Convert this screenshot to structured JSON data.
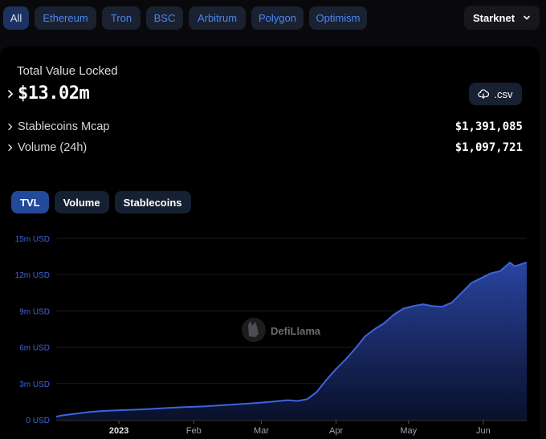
{
  "chain_filters": [
    "All",
    "Ethereum",
    "Tron",
    "BSC",
    "Arbitrum",
    "Polygon",
    "Optimism"
  ],
  "active_filter": "All",
  "chain_select": {
    "value": "Starknet"
  },
  "tvl": {
    "label": "Total Value Locked",
    "value": "$13.02m"
  },
  "csv_button": {
    "label": ".csv"
  },
  "stats": [
    {
      "label": "Stablecoins Mcap",
      "value": "$1,391,085"
    },
    {
      "label": "Volume (24h)",
      "value": "$1,097,721"
    }
  ],
  "tabs": [
    "TVL",
    "Volume",
    "Stablecoins"
  ],
  "active_tab": "TVL",
  "watermark": "DefiLlama",
  "colors": {
    "accent": "#4b86f2",
    "series": "#3e63dd",
    "active_tab": "#23499b"
  },
  "chart_data": {
    "type": "area",
    "y_ticks": [
      "15m USD",
      "12m USD",
      "9m USD",
      "6m USD",
      "3m USD",
      "0 USD"
    ],
    "x_ticks": [
      "2023",
      "Feb",
      "Mar",
      "Apr",
      "May",
      "Jun"
    ],
    "ylim": [
      0,
      15000000
    ],
    "grid": true,
    "series": [
      {
        "x": [
          "2022-12-06",
          "2022-12-08",
          "2022-12-14",
          "2022-12-20",
          "2022-12-27",
          "2023-01-04",
          "2023-01-12",
          "2023-01-20",
          "2023-01-28",
          "2023-02-05",
          "2023-02-13",
          "2023-02-21",
          "2023-02-28",
          "2023-03-06",
          "2023-03-12",
          "2023-03-16",
          "2023-03-20",
          "2023-03-24",
          "2023-03-28",
          "2023-04-01",
          "2023-04-05",
          "2023-04-09",
          "2023-04-13",
          "2023-04-17",
          "2023-04-21",
          "2023-04-25",
          "2023-04-29",
          "2023-05-03",
          "2023-05-07",
          "2023-05-11",
          "2023-05-15",
          "2023-05-19",
          "2023-05-23",
          "2023-05-27",
          "2023-05-31",
          "2023-06-04",
          "2023-06-08",
          "2023-06-12",
          "2023-06-14",
          "2023-06-19"
        ],
        "values": [
          250000,
          350000,
          500000,
          650000,
          750000,
          800000,
          870000,
          960000,
          1050000,
          1100000,
          1200000,
          1300000,
          1400000,
          1500000,
          1620000,
          1550000,
          1700000,
          2300000,
          3300000,
          4200000,
          5000000,
          5900000,
          6900000,
          7500000,
          8000000,
          8700000,
          9200000,
          9400000,
          9550000,
          9400000,
          9350000,
          9700000,
          10500000,
          11300000,
          11700000,
          12100000,
          12300000,
          13000000,
          12700000,
          13000000
        ]
      }
    ]
  }
}
